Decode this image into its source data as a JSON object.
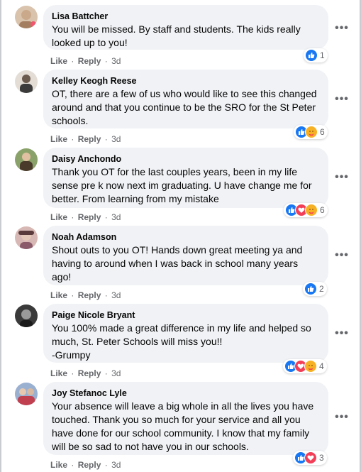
{
  "actions": {
    "like": "Like",
    "reply": "Reply",
    "separator": "·"
  },
  "more_label": "•••",
  "comments": [
    {
      "author": "Lisa Battcher",
      "text": "You will be missed. By staff and students. The kids really looked up to you!",
      "time": "3d",
      "reactions": [
        "like-reaction-icon"
      ],
      "reaction_count": "1",
      "avatar_color": "#c9a98a"
    },
    {
      "author": "Kelley Keogh Reese",
      "text": "OT, there are a few of us who would like to see this changed around and that you continue to be the SRO for the St Peter schools.",
      "time": "3d",
      "reactions": [
        "like-reaction-icon",
        "care-reaction-icon"
      ],
      "reaction_count": "6",
      "avatar_color": "#6b5b4e"
    },
    {
      "author": "Daisy Anchondo",
      "text": "Thank you OT for the last couples years, been in my life sense pre k now next im graduating. U have change me for better. From learning from my mistake",
      "time": "3d",
      "reactions": [
        "like-reaction-icon",
        "love-reaction-icon",
        "care-reaction-icon"
      ],
      "reaction_count": "6",
      "avatar_color": "#5f7a4a"
    },
    {
      "author": "Noah Adamson",
      "text": "Shout outs to you OT! Hands down great meeting ya and having to around when I was back in school many years ago!",
      "time": "3d",
      "reactions": [
        "like-reaction-icon"
      ],
      "reaction_count": "2",
      "avatar_color": "#b58a86"
    },
    {
      "author": "Paige Nicole Bryant",
      "text": "You 100% made a great difference in my life and helped so much, St. Peter Schools will miss you!!\n-Grumpy",
      "time": "3d",
      "reactions": [
        "like-reaction-icon",
        "love-reaction-icon",
        "care-reaction-icon"
      ],
      "reaction_count": "4",
      "avatar_color": "#2f2f2f"
    },
    {
      "author": "Joy Stefanoc Lyle",
      "text": "Your absence will leave a big whole in all the lives you have touched. Thank you so much for your service and all you have done for our school community. I know that my family will be so sad to not have you in our schools.",
      "time": "3d",
      "reactions": [
        "like-reaction-icon",
        "love-reaction-icon"
      ],
      "reaction_count": "3",
      "avatar_color": "#7d95b8"
    }
  ],
  "colors": {
    "bubble": "#f0f2f5",
    "secondary_text": "#65676b",
    "like": "#1877f2",
    "love": "#f33e58",
    "care": "#f7b125"
  }
}
